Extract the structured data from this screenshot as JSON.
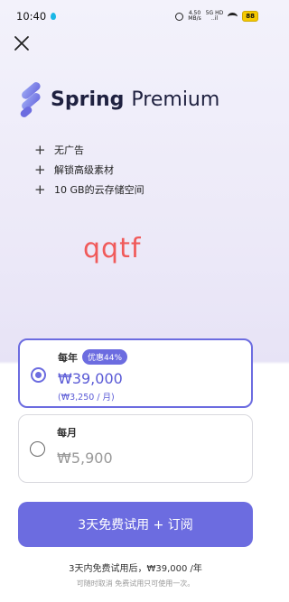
{
  "status_bar": {
    "time": "10:40",
    "speed_value": "4.50",
    "speed_unit": "MB/s",
    "network_top": "5G HD",
    "network_bottom": "..il",
    "battery": "88"
  },
  "brand": {
    "name": "Spring",
    "suffix": "Premium",
    "accent_color": "#6c6ce0"
  },
  "features": [
    {
      "label": "无广告"
    },
    {
      "label": "解锁高级素材"
    },
    {
      "label": "10 GB的云存储空间"
    }
  ],
  "watermark": "qqtf",
  "plans": {
    "yearly": {
      "title": "每年",
      "badge": "优惠44%",
      "price": "₩39,000",
      "per_month": "(₩3,250 / 月)",
      "selected": true
    },
    "monthly": {
      "title": "每月",
      "price": "₩5,900",
      "selected": false
    }
  },
  "cta": {
    "label": "3天免费试用 + 订阅"
  },
  "notes": {
    "trial": "3天内免费试用后，₩39,000 /年",
    "cancel": "可随时取消  免费试用只可使用一次。"
  }
}
